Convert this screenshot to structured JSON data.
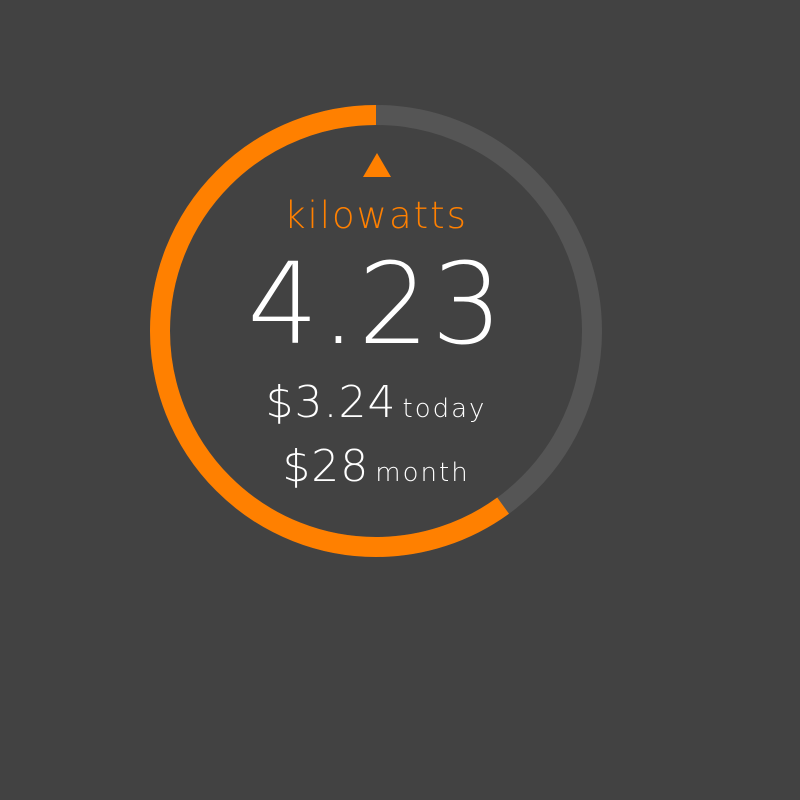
{
  "gauge": {
    "progress_fraction": 0.6,
    "accent_color": "#ff8000",
    "track_color": "#555555",
    "background_color": "#424242",
    "trend_icon": "triangle-up-icon"
  },
  "reading": {
    "unit": "kilowatts",
    "value": "4.23"
  },
  "costs": {
    "today_amount": "$3.24",
    "today_label": "today",
    "month_amount": "$28",
    "month_label": "month"
  }
}
